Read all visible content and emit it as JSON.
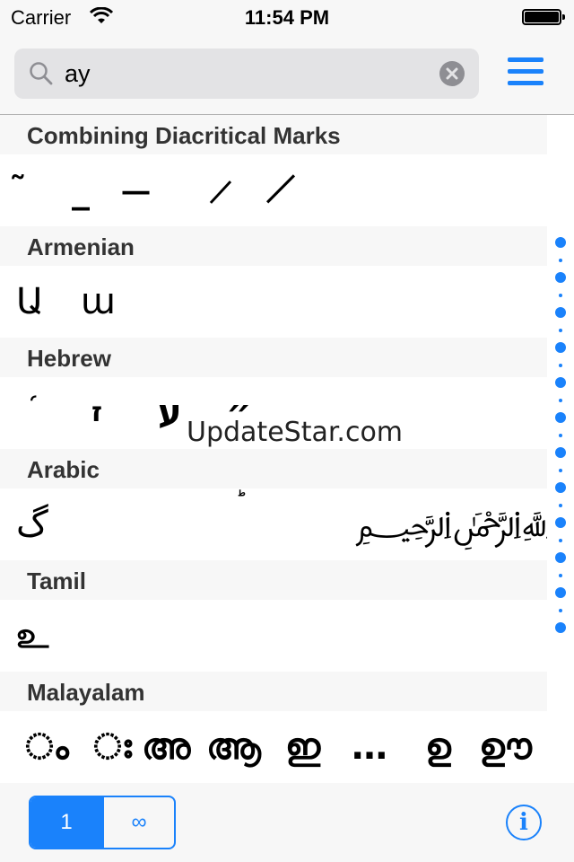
{
  "status_bar": {
    "carrier": "Carrier",
    "time": "11:54 PM"
  },
  "search": {
    "value": "ay",
    "icon": "search-icon"
  },
  "sections": [
    {
      "title": "Combining Diacritical Marks",
      "chars": [
        "̃",
        "̲",
        "̶",
        "̷",
        "̸"
      ]
    },
    {
      "title": "Armenian",
      "chars": [
        "Ա",
        "ա"
      ]
    },
    {
      "title": "Hebrew",
      "chars": [
        "֜",
        "ז",
        "ע",
        "״"
      ]
    },
    {
      "title": "Arabic",
      "chars": [
        "گ",
        "ؕ",
        "﷽"
      ]
    },
    {
      "title": "Tamil",
      "chars": [
        "உ"
      ]
    },
    {
      "title": "Malayalam",
      "chars": [
        "ം",
        "ഃ",
        "അ",
        "ആ",
        "ഇ",
        "…",
        "ഉ",
        "ഊ"
      ]
    }
  ],
  "watermark": "UpdateStar.com",
  "toolbar": {
    "segments": [
      "1",
      "∞"
    ],
    "selected_segment": "1",
    "info_label": "i"
  },
  "colors": {
    "accent": "#1a82fb",
    "section_bg": "#f7f7f7"
  }
}
